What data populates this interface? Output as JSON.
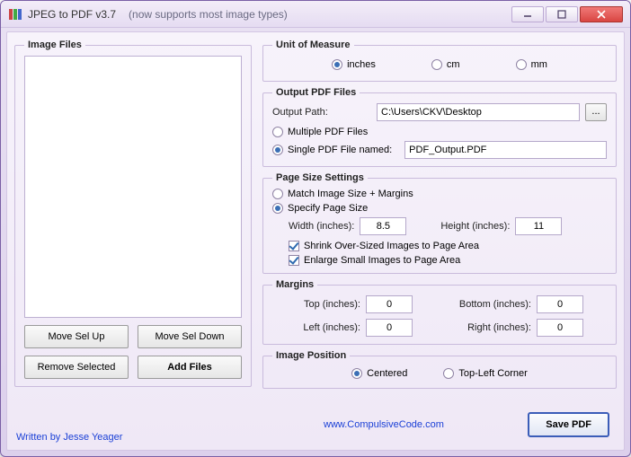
{
  "title": {
    "main": "JPEG to PDF  v3.7",
    "sub": "(now supports most image types)"
  },
  "left": {
    "legend": "Image Files",
    "moveUp": "Move Sel Up",
    "moveDown": "Move Sel Down",
    "remove": "Remove Selected",
    "add": "Add Files"
  },
  "unit": {
    "legend": "Unit of Measure",
    "inches": "inches",
    "cm": "cm",
    "mm": "mm"
  },
  "output": {
    "legend": "Output PDF Files",
    "pathLabel": "Output Path:",
    "pathValue": "C:\\Users\\CKV\\Desktop",
    "browse": "...",
    "multi": "Multiple PDF Files",
    "singleLabel": "Single PDF File named:",
    "singleValue": "PDF_Output.PDF"
  },
  "page": {
    "legend": "Page Size Settings",
    "match": "Match Image Size + Margins",
    "specify": "Specify Page Size",
    "widthLabel": "Width (inches):",
    "widthValue": "8.5",
    "heightLabel": "Height (inches):",
    "heightValue": "11",
    "shrink": "Shrink Over-Sized Images to Page Area",
    "enlarge": "Enlarge Small Images to Page Area"
  },
  "margins": {
    "legend": "Margins",
    "topLabel": "Top (inches):",
    "topValue": "0",
    "bottomLabel": "Bottom (inches):",
    "bottomValue": "0",
    "leftLabel": "Left (inches):",
    "leftValue": "0",
    "rightLabel": "Right (inches):",
    "rightValue": "0"
  },
  "pos": {
    "legend": "Image Position",
    "centered": "Centered",
    "topleft": "Top-Left Corner"
  },
  "footer": {
    "written": "Written by Jesse Yeager",
    "site": "www.CompulsiveCode.com",
    "save": "Save PDF"
  }
}
